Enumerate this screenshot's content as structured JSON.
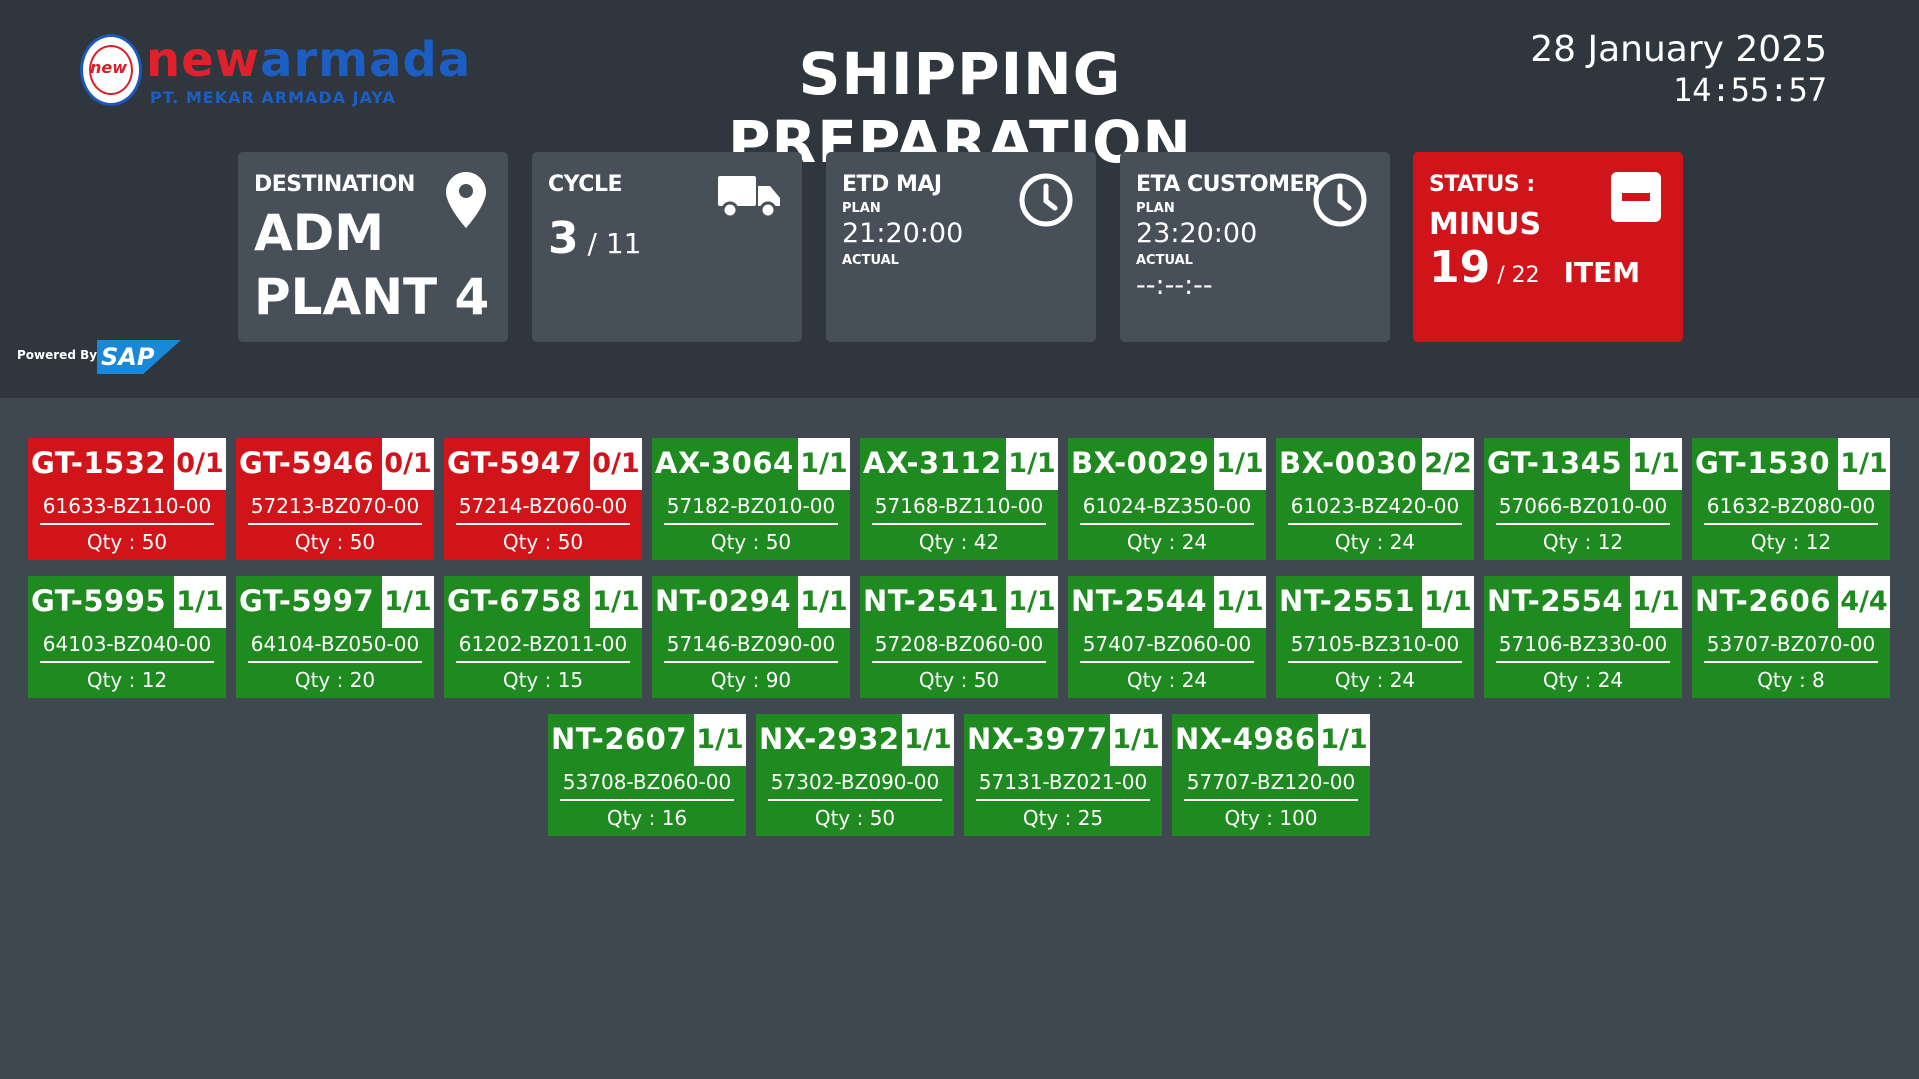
{
  "header": {
    "logo": {
      "emblem_text": "new",
      "brand_part1": "new",
      "brand_part2": "armada",
      "subtitle": "PT. MEKAR ARMADA JAYA"
    },
    "title": "SHIPPING PREPARATION",
    "date": "28 January 2025",
    "time": "14:55:57",
    "powered_by": "Powered By",
    "powered_brand": "SAP"
  },
  "cards": {
    "destination": {
      "label": "DESTINATION",
      "line1": "ADM",
      "line2": "PLANT 4",
      "icon": "location-pin-icon"
    },
    "cycle": {
      "label": "CYCLE",
      "current": "3",
      "total": "11",
      "icon": "truck-icon"
    },
    "etd": {
      "label": "ETD MAJ",
      "plan_label": "PLAN",
      "plan": "21:20:00",
      "actual_label": "ACTUAL",
      "actual": "",
      "icon": "clock-icon"
    },
    "eta": {
      "label": "ETA CUSTOMER",
      "plan_label": "PLAN",
      "plan": "23:20:00",
      "actual_label": "ACTUAL",
      "actual": "--:--:--",
      "icon": "clock-icon"
    },
    "status": {
      "label": "STATUS :",
      "value": "MINUS",
      "count": "19",
      "total": "22",
      "unit": "ITEM",
      "icon": "minus-square-icon",
      "color": "#d0141a"
    }
  },
  "colors": {
    "ok": "#1f8a1f",
    "minus": "#d0141a",
    "background": "#3f474f",
    "header": "#2f363e"
  },
  "parts": [
    {
      "code": "GT-1532",
      "frac": "0/1",
      "part_no": "61633-BZ110-00",
      "qty": "Qty : 50",
      "status": "minus"
    },
    {
      "code": "GT-5946",
      "frac": "0/1",
      "part_no": "57213-BZ070-00",
      "qty": "Qty : 50",
      "status": "minus"
    },
    {
      "code": "GT-5947",
      "frac": "0/1",
      "part_no": "57214-BZ060-00",
      "qty": "Qty : 50",
      "status": "minus"
    },
    {
      "code": "AX-3064",
      "frac": "1/1",
      "part_no": "57182-BZ010-00",
      "qty": "Qty : 50",
      "status": "ok"
    },
    {
      "code": "AX-3112",
      "frac": "1/1",
      "part_no": "57168-BZ110-00",
      "qty": "Qty : 42",
      "status": "ok"
    },
    {
      "code": "BX-0029",
      "frac": "1/1",
      "part_no": "61024-BZ350-00",
      "qty": "Qty : 24",
      "status": "ok"
    },
    {
      "code": "BX-0030",
      "frac": "2/2",
      "part_no": "61023-BZ420-00",
      "qty": "Qty : 24",
      "status": "ok"
    },
    {
      "code": "GT-1345",
      "frac": "1/1",
      "part_no": "57066-BZ010-00",
      "qty": "Qty : 12",
      "status": "ok"
    },
    {
      "code": "GT-1530",
      "frac": "1/1",
      "part_no": "61632-BZ080-00",
      "qty": "Qty : 12",
      "status": "ok"
    },
    {
      "code": "GT-5995",
      "frac": "1/1",
      "part_no": "64103-BZ040-00",
      "qty": "Qty : 12",
      "status": "ok"
    },
    {
      "code": "GT-5997",
      "frac": "1/1",
      "part_no": "64104-BZ050-00",
      "qty": "Qty : 20",
      "status": "ok"
    },
    {
      "code": "GT-6758",
      "frac": "1/1",
      "part_no": "61202-BZ011-00",
      "qty": "Qty : 15",
      "status": "ok"
    },
    {
      "code": "NT-0294",
      "frac": "1/1",
      "part_no": "57146-BZ090-00",
      "qty": "Qty : 90",
      "status": "ok"
    },
    {
      "code": "NT-2541",
      "frac": "1/1",
      "part_no": "57208-BZ060-00",
      "qty": "Qty : 50",
      "status": "ok"
    },
    {
      "code": "NT-2544",
      "frac": "1/1",
      "part_no": "57407-BZ060-00",
      "qty": "Qty : 24",
      "status": "ok"
    },
    {
      "code": "NT-2551",
      "frac": "1/1",
      "part_no": "57105-BZ310-00",
      "qty": "Qty : 24",
      "status": "ok"
    },
    {
      "code": "NT-2554",
      "frac": "1/1",
      "part_no": "57106-BZ330-00",
      "qty": "Qty : 24",
      "status": "ok"
    },
    {
      "code": "NT-2606",
      "frac": "4/4",
      "part_no": "53707-BZ070-00",
      "qty": "Qty : 8",
      "status": "ok"
    },
    {
      "code": "NT-2607",
      "frac": "1/1",
      "part_no": "53708-BZ060-00",
      "qty": "Qty : 16",
      "status": "ok"
    },
    {
      "code": "NX-2932",
      "frac": "1/1",
      "part_no": "57302-BZ090-00",
      "qty": "Qty : 50",
      "status": "ok"
    },
    {
      "code": "NX-3977",
      "frac": "1/1",
      "part_no": "57131-BZ021-00",
      "qty": "Qty : 25",
      "status": "ok"
    },
    {
      "code": "NX-4986",
      "frac": "1/1",
      "part_no": "57707-BZ120-00",
      "qty": "Qty : 100",
      "status": "ok"
    }
  ]
}
